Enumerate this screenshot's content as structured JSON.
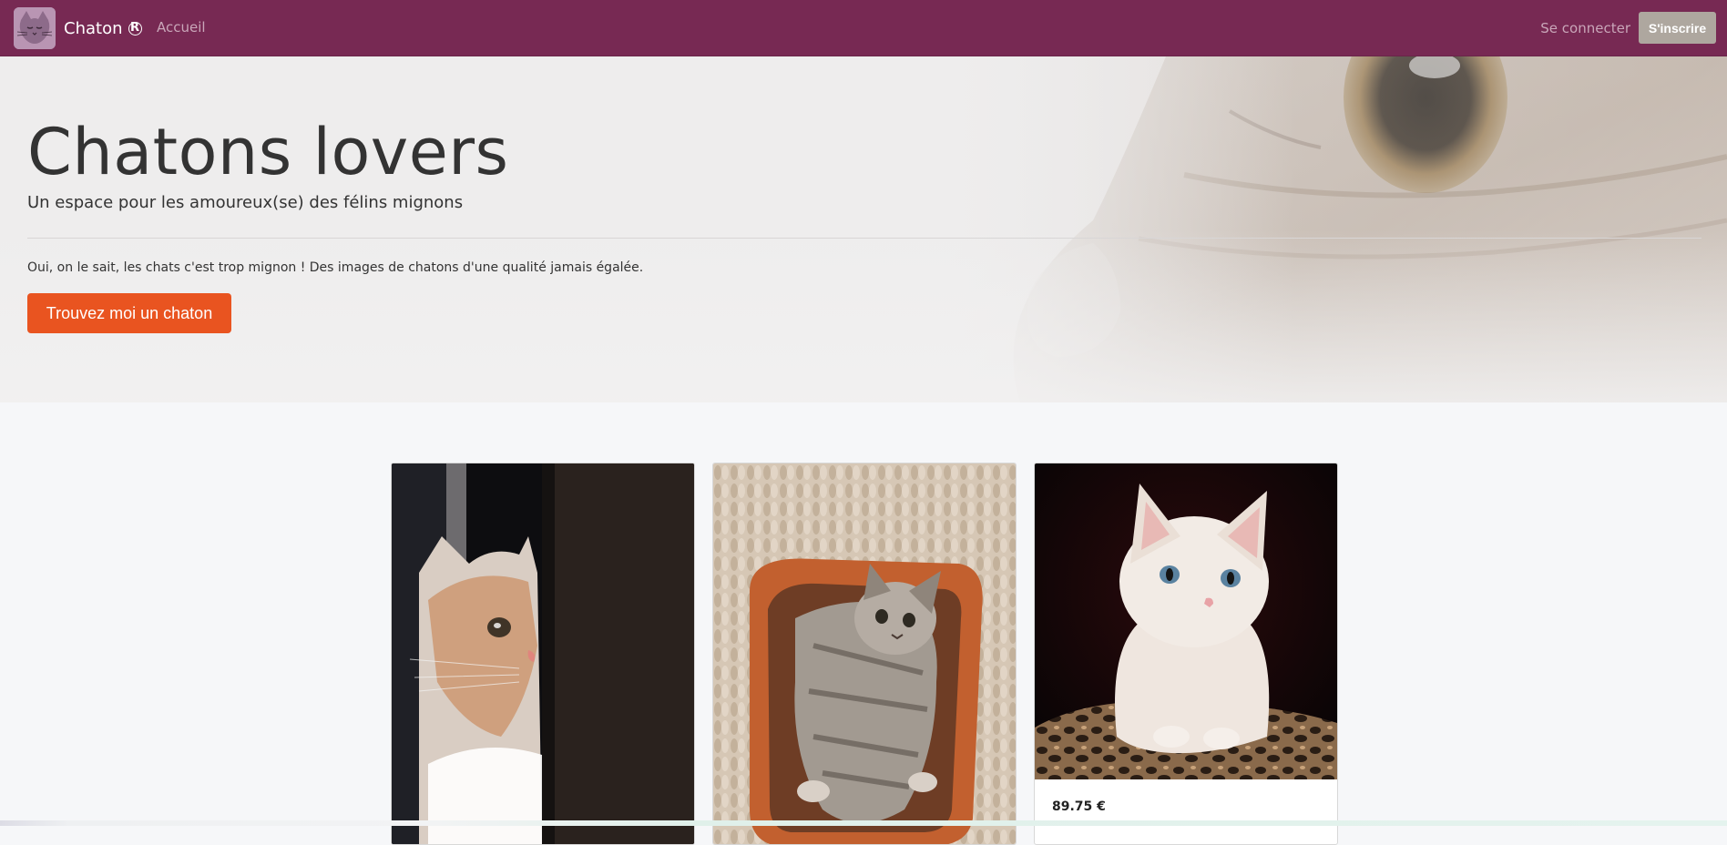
{
  "navbar": {
    "brand_name": "Chaton",
    "brand_mark": "R",
    "home_link": "Accueil",
    "login_link": "Se connecter",
    "signup_button": "S'inscrire",
    "background_color": "#772953"
  },
  "hero": {
    "title": "Chatons lovers",
    "lead": "Un espace pour les amoureux(se) des félins mignons",
    "text": "Oui, on le sait, les chats c'est trop mignon ! Des images de chatons d'une qualité jamais égalée.",
    "cta_button": "Trouvez moi un chaton",
    "cta_color": "#e95420"
  },
  "cards": [
    {
      "image": "kitten-peeking-photo",
      "price": ""
    },
    {
      "image": "kitten-in-basket-photo",
      "price": ""
    },
    {
      "image": "white-kitten-photo",
      "price": "89.75 €"
    }
  ],
  "colors": {
    "page_background": "#f6f7f9",
    "signup_button": "#aea79f"
  }
}
